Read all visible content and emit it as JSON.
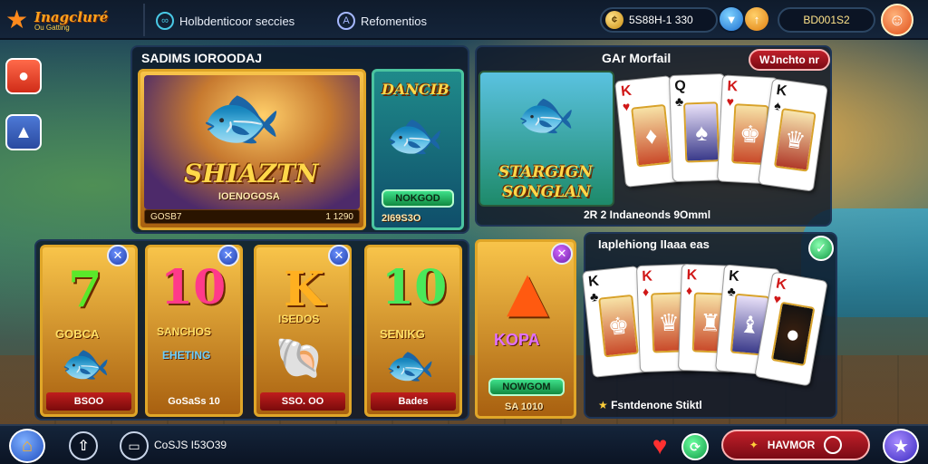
{
  "colors": {
    "accent_gold": "#e0a628",
    "accent_teal": "#4ac4a0",
    "brand_orange": "#ff8a1c",
    "action_red": "#c01d1d"
  },
  "header": {
    "logo_main": "Inagcluré",
    "logo_sub": "Ou Gatting",
    "nav": [
      {
        "label": "Holbdenticoor seccies",
        "icon": "link-icon"
      },
      {
        "label": "Refomentios",
        "icon": "a-badge-icon"
      }
    ],
    "coins": "5S88H-1 330",
    "gems": "BD001S2"
  },
  "featured": {
    "title": "SADIMS IOROODAJ",
    "main_game": {
      "title": "SHIAZTN",
      "subtitle": "IOENOGOSA",
      "progress_left": "GOSB7",
      "progress_right": "1 1290"
    },
    "side_game": {
      "title": "DANCIB",
      "button": "NOKGOD",
      "value": "2I69S3O"
    }
  },
  "slots": [
    {
      "symbol": "7",
      "name": "GOBCA",
      "price": "BSOO"
    },
    {
      "symbol": "10",
      "name": "SANCHOS",
      "sub": "EHETING",
      "price": "GoSaSs 10"
    },
    {
      "symbol": "K",
      "name": "ISEDOS",
      "price": "SSO. OO"
    },
    {
      "symbol": "10",
      "name": "SENIKG",
      "price": "Bades"
    }
  ],
  "feature_slot": {
    "name": "KOPA",
    "button": "NOWGOM",
    "price": "SA 1010"
  },
  "card_game_top": {
    "title": "GAr Morfail",
    "tag": "WJnchto nr",
    "art_title": "STARGIGN",
    "art_sub": "SONGLAN",
    "footer": "2R 2 Indaneonds 9Omml"
  },
  "card_game_bottom": {
    "title": "Iaplehiong IIaaa eas",
    "footer": "Fsntdenone Stiktl"
  },
  "footer": {
    "balance": "CoSJS I53O39",
    "action": "HAVMOR"
  }
}
